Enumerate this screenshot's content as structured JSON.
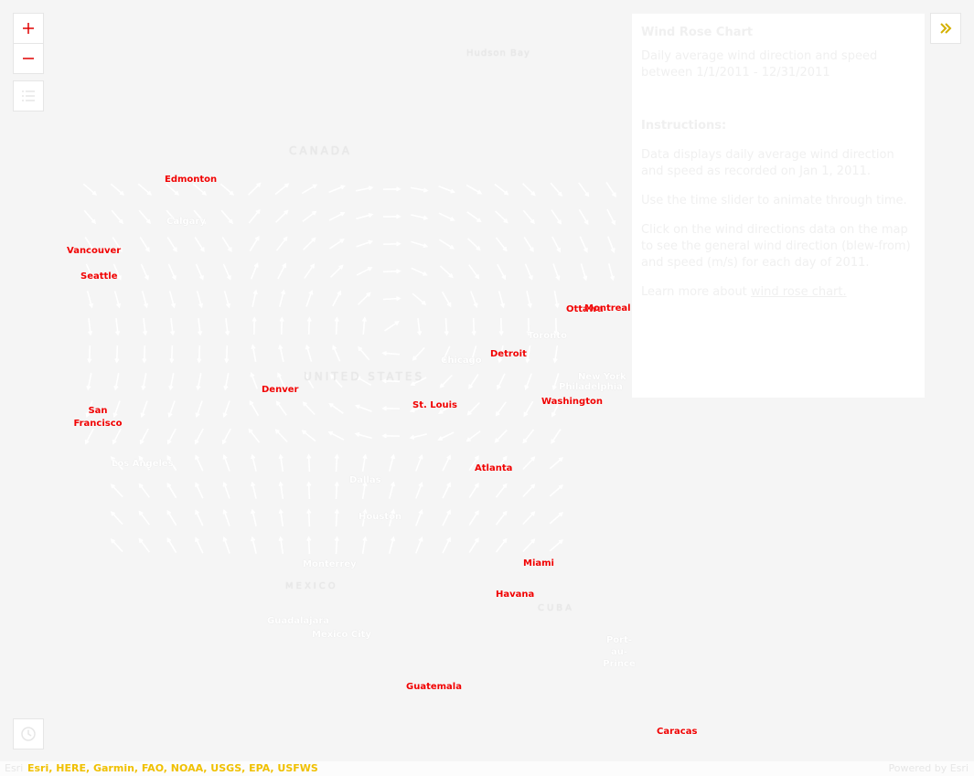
{
  "map": {
    "cities_red": [
      "Edmonton",
      "Vancouver",
      "Seattle",
      "San Francisco",
      "Denver",
      "St. Louis",
      "Detroit",
      "Washington",
      "Ottawa",
      "Montreal",
      "Atlanta",
      "Miami",
      "Havana",
      "Guatemala",
      "Caracas"
    ],
    "cities_grey": [
      "Calgary",
      "Toronto",
      "Chicago",
      "New York",
      "Philadelphia",
      "Los Angeles",
      "Dallas",
      "Houston",
      "Monterrey",
      "Guadalajara",
      "Mexico City",
      "Port-au-Prince"
    ],
    "regions": [
      "CANADA",
      "UNITED STATES",
      "MEXICO",
      "CUBA",
      "Hudson Bay"
    ],
    "red_label_color": "#f00000",
    "attribution_color": "#f0c000"
  },
  "controls": {
    "zoom_in_icon": "plus-icon",
    "zoom_out_icon": "minus-icon",
    "legend_icon": "list-icon",
    "expand_icon": "double-chevron-right-icon",
    "time_icon": "clock-icon"
  },
  "panel": {
    "title": "Wind Rose Chart",
    "subtitle": "Daily average wind direction and speed between 1/1/2011 - 12/31/2011",
    "instructions_heading": "Instructions:",
    "para1": "Data displays daily average wind direction and speed as recorded on Jan 1, 2011.",
    "para2": "Use the time slider to animate through time.",
    "para3": "Click on the wind directions data on the map to see the general wind direction (blew-from) and speed (m/s) for each day of 2011.",
    "para4_prefix": "Learn more about ",
    "para4_link": "wind rose chart."
  },
  "attribution": {
    "esri": "Esri",
    "sources": "Esri, HERE, Garmin, FAO, NOAA, USGS, EPA, USFWS",
    "powered": "Powered by Esri"
  }
}
